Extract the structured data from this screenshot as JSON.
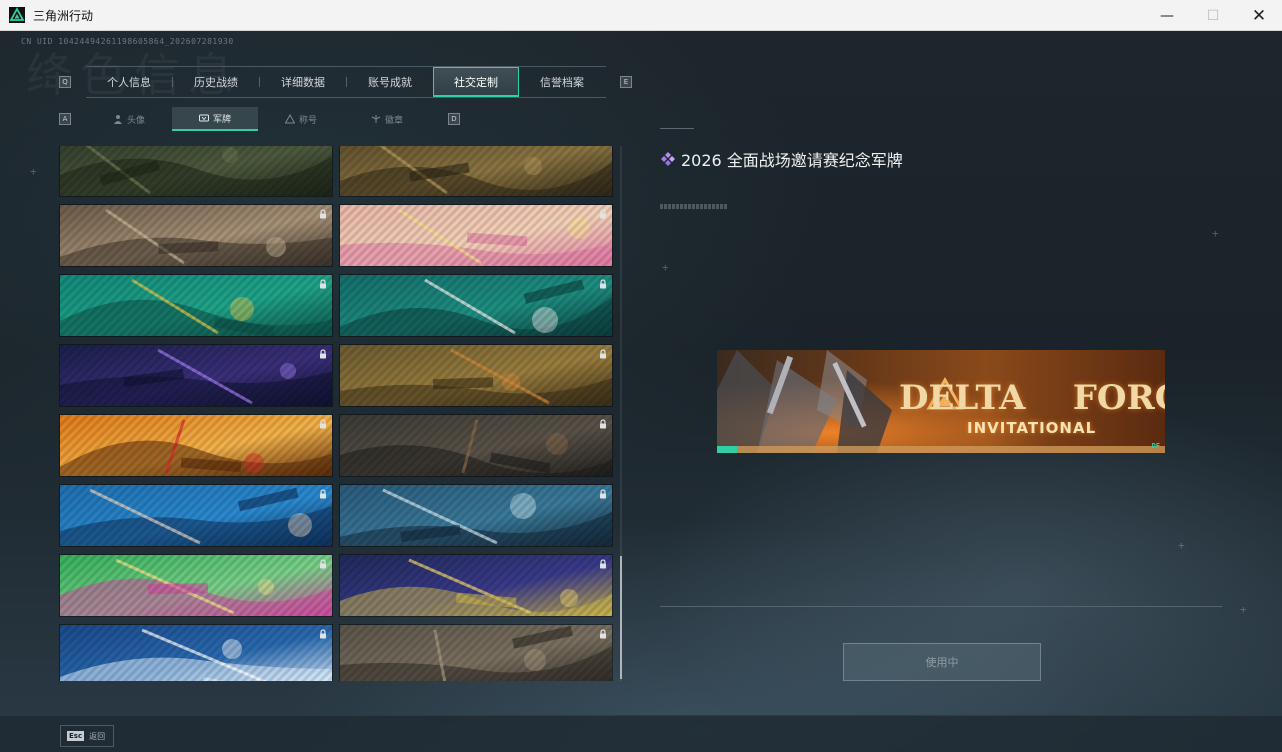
{
  "window": {
    "title": "三角洲行动",
    "minimize": "—",
    "maximize": "☐",
    "close": "✕"
  },
  "header": {
    "uid": "CN UID 10424494261198605864_202607281930",
    "watermark": "绛色信息"
  },
  "tabs": {
    "left_key": "Q",
    "right_key": "E",
    "items": [
      {
        "label": "个人信息",
        "active": false
      },
      {
        "label": "历史战绩",
        "active": false
      },
      {
        "label": "详细数据",
        "active": false
      },
      {
        "label": "账号成就",
        "active": false
      },
      {
        "label": "社交定制",
        "active": true
      },
      {
        "label": "信誉档案",
        "active": false
      }
    ]
  },
  "subtabs": {
    "left_key": "A",
    "right_key": "D",
    "items": [
      {
        "label": "头像",
        "icon": "person-icon",
        "active": false
      },
      {
        "label": "军牌",
        "icon": "dogtag-icon",
        "active": true
      },
      {
        "label": "称号",
        "icon": "triangle-badge-icon",
        "active": false
      },
      {
        "label": "徽章",
        "icon": "emblem-icon",
        "active": false
      }
    ]
  },
  "cards": [
    {
      "palette": [
        "#2f3a2a",
        "#4d5a3e",
        "#1c2418"
      ],
      "locked": false,
      "accent": "#6b7a52"
    },
    {
      "palette": [
        "#5a4a2a",
        "#8a7442",
        "#2d2616"
      ],
      "locked": false,
      "accent": "#b49a5a"
    },
    {
      "palette": [
        "#6b5a48",
        "#a89278",
        "#3a3128"
      ],
      "locked": true,
      "accent": "#c9b79a"
    },
    {
      "palette": [
        "#e9b7a8",
        "#f3d0b8",
        "#e07aa4"
      ],
      "locked": true,
      "accent": "#f6e08a"
    },
    {
      "palette": [
        "#13897a",
        "#1fa489",
        "#0d4f47"
      ],
      "locked": true,
      "accent": "#e4c84a"
    },
    {
      "palette": [
        "#146d6a",
        "#1e8f82",
        "#0b3d3c"
      ],
      "locked": true,
      "accent": "#f0f0f0"
    },
    {
      "palette": [
        "#1a1f4a",
        "#3a2f7a",
        "#0e1230"
      ],
      "locked": true,
      "accent": "#a07cf0"
    },
    {
      "palette": [
        "#6a5a30",
        "#9a7e3e",
        "#3a2d18"
      ],
      "locked": true,
      "accent": "#d08a3a"
    },
    {
      "palette": [
        "#e07a1a",
        "#f3b24a",
        "#5a2a0a"
      ],
      "locked": true,
      "accent": "#d82a2a"
    },
    {
      "palette": [
        "#3a3a34",
        "#5a5248",
        "#1e1e1c"
      ],
      "locked": true,
      "accent": "#8a6a4a"
    },
    {
      "palette": [
        "#1f6fb0",
        "#2a8ad0",
        "#0f2f5a"
      ],
      "locked": true,
      "accent": "#e7d2c0"
    },
    {
      "palette": [
        "#2a5a7a",
        "#3a7a9a",
        "#14283a"
      ],
      "locked": true,
      "accent": "#cfe6f0"
    },
    {
      "palette": [
        "#34b05a",
        "#7ad08a",
        "#d04aa0"
      ],
      "locked": true,
      "accent": "#f0e68a"
    },
    {
      "palette": [
        "#1f2a5a",
        "#3a3a8a",
        "#c9b44a"
      ],
      "locked": true,
      "accent": "#f3d86a"
    },
    {
      "palette": [
        "#1a4a8a",
        "#2a6ab0",
        "#e0f0ff"
      ],
      "locked": true,
      "accent": "#ffffff"
    },
    {
      "palette": [
        "#5a5448",
        "#7a7060",
        "#2e2a24"
      ],
      "locked": true,
      "accent": "#a89a82"
    }
  ],
  "detail": {
    "title": "2026 全面战场邀请赛纪念军牌",
    "preview": {
      "line1": "DELTA",
      "line1b": "FORCE",
      "line2": "INVITATIONAL",
      "badge": "DF"
    },
    "use_button": "使用中"
  },
  "footer": {
    "esc_key": "Esc",
    "esc_label": "返回"
  }
}
